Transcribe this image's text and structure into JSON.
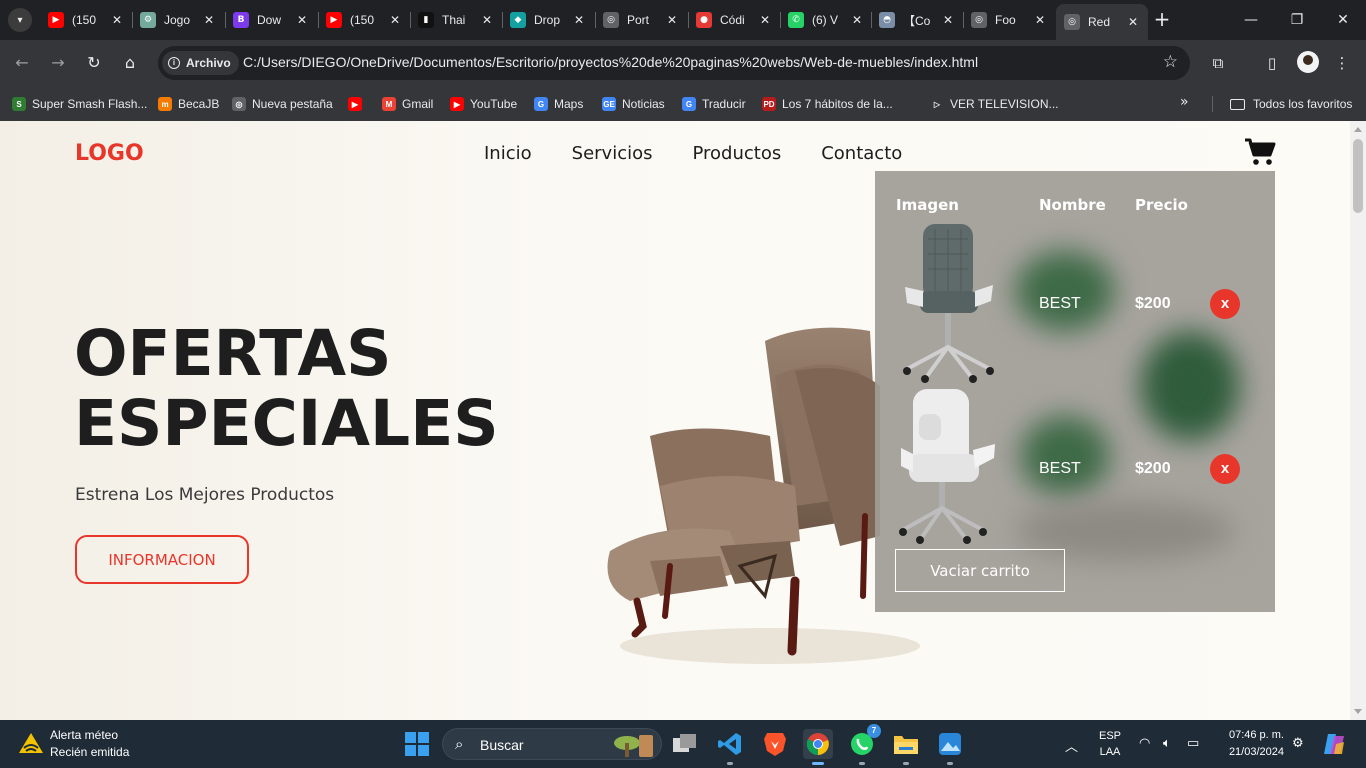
{
  "browser": {
    "tabs": [
      {
        "label": "(150",
        "fav_color": "#ff0000",
        "fav_text": "▶"
      },
      {
        "label": "Jogo",
        "fav_color": "#74aa9c",
        "fav_text": "⚙"
      },
      {
        "label": "Dow",
        "fav_color": "#7c3aed",
        "fav_text": "B"
      },
      {
        "label": "(150",
        "fav_color": "#ff0000",
        "fav_text": "▶"
      },
      {
        "label": "Thai",
        "fav_color": "#111111",
        "fav_text": "▮"
      },
      {
        "label": "Drop",
        "fav_color": "#14a0a0",
        "fav_text": "◆"
      },
      {
        "label": "Port",
        "fav_color": "#5f6368",
        "fav_text": "◎"
      },
      {
        "label": "Códi",
        "fav_color": "#e53935",
        "fav_text": "●"
      },
      {
        "label": "(6) V",
        "fav_color": "#25d366",
        "fav_text": "✆"
      },
      {
        "label": "【Co",
        "fav_color": "#7a8ea8",
        "fav_text": "◓"
      },
      {
        "label": "Foo",
        "fav_color": "#5f6368",
        "fav_text": "◎"
      },
      {
        "label": "Red",
        "fav_color": "#5f6368",
        "fav_text": "◎"
      }
    ],
    "address": {
      "chip_label": "Archivo",
      "url": "C:/Users/DIEGO/OneDrive/Documentos/Escritorio/proyectos%20de%20paginas%20webs/Web-de-muebles/index.html"
    },
    "bookmarks": [
      {
        "label": "Super Smash Flash...",
        "fav_color": "#2e7d32",
        "fav_text": "S"
      },
      {
        "label": "BecaJB",
        "fav_color": "#f57c00",
        "fav_text": "m"
      },
      {
        "label": "Nueva pestaña",
        "fav_color": "#5f6368",
        "fav_text": "◎"
      },
      {
        "label": "",
        "fav_color": "#ff0000",
        "fav_text": "▶"
      },
      {
        "label": "Gmail",
        "fav_color": "#ea4335",
        "fav_text": "M"
      },
      {
        "label": "YouTube",
        "fav_color": "#ff0000",
        "fav_text": "▶"
      },
      {
        "label": "Maps",
        "fav_color": "#4285f4",
        "fav_text": "G"
      },
      {
        "label": "Noticias",
        "fav_color": "#4285f4",
        "fav_text": "GE"
      },
      {
        "label": "Traducir",
        "fav_color": "#4285f4",
        "fav_text": "G"
      },
      {
        "label": "Los 7 hábitos de la...",
        "fav_color": "#b71c1c",
        "fav_text": "PD"
      },
      {
        "label": "VER TELEVISION...",
        "fav_color": "",
        "fav_text": "▷"
      }
    ],
    "all_bookmarks_label": "Todos los favoritos"
  },
  "page": {
    "logo": "LOGO",
    "nav": [
      "Inicio",
      "Servicios",
      "Productos",
      "Contacto"
    ],
    "hero": {
      "title_line1": "OFERTAS",
      "title_line2": "ESPECIALES",
      "subtitle": "Estrena Los Mejores Productos",
      "button": "INFORMACION"
    },
    "cart": {
      "headers": {
        "image": "Imagen",
        "name": "Nombre",
        "price": "Precio"
      },
      "items": [
        {
          "name": "BEST",
          "price": "$200",
          "remove": "x",
          "chair_color": "#5f6b6a"
        },
        {
          "name": "BEST",
          "price": "$200",
          "remove": "x",
          "chair_color": "#e8e8e8"
        }
      ],
      "empty_button": "Vaciar carrito"
    }
  },
  "taskbar": {
    "weather_title": "Alerta méteo",
    "weather_sub": "Recién emitida",
    "search_placeholder": "Buscar",
    "whatsapp_badge": "7",
    "lang_top": "ESP",
    "lang_bottom": "LAA",
    "time": "07:46 p. m.",
    "date": "21/03/2024"
  },
  "colors": {
    "accent": "#e8362b",
    "browser_dark": "#202124",
    "browser_toolbar": "#35363a",
    "page_bg": "#fbf9f4",
    "taskbar": "#1f2b36"
  }
}
